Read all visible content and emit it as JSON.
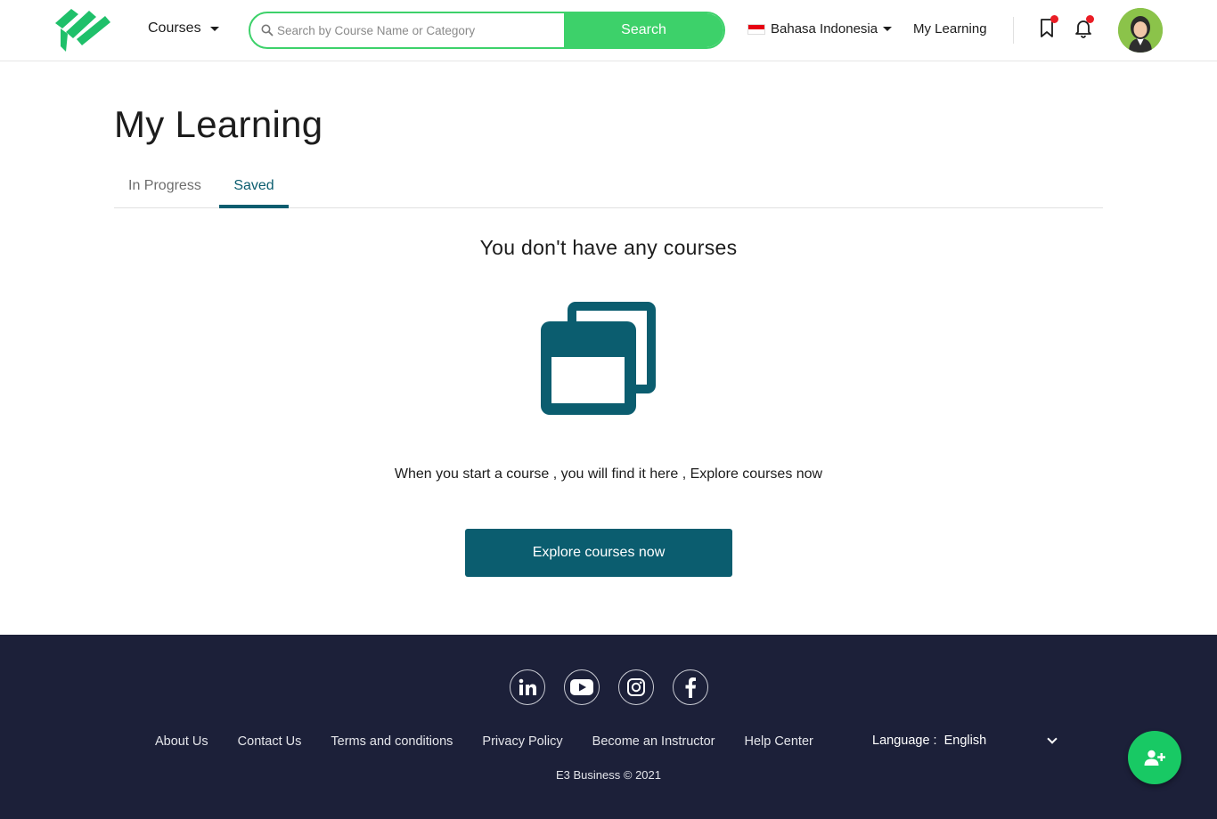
{
  "header": {
    "courses_label": "Courses",
    "search": {
      "placeholder": "Search by Course Name or Category",
      "value": "",
      "button_label": "Search"
    },
    "language": {
      "label": "Bahasa Indonesia",
      "flag": "indonesia-flag"
    },
    "my_learning_label": "My Learning",
    "icons": {
      "bookmark": "bookmark-icon",
      "notification": "bell-icon"
    }
  },
  "main": {
    "title": "My Learning",
    "tabs": [
      {
        "label": "In Progress",
        "active": false
      },
      {
        "label": "Saved",
        "active": true
      }
    ],
    "empty_state": {
      "title": "You don't have any courses",
      "icon": "copy-windows-icon",
      "description": "When you start a course , you will find it here , Explore courses now",
      "button_label": "Explore courses now"
    }
  },
  "footer": {
    "socials": [
      "linkedin-icon",
      "youtube-icon",
      "instagram-icon",
      "facebook-icon"
    ],
    "links": [
      "About Us",
      "Contact Us",
      "Terms and conditions",
      "Privacy Policy",
      "Become an Instructor",
      "Help Center"
    ],
    "language_label": "Language :",
    "language_value": "English",
    "copyright": "E3 Business © 2021"
  },
  "fab": {
    "icon": "add-user-icon"
  },
  "colors": {
    "brand_green": "#3dd16a",
    "primary_teal": "#0b5d6f",
    "footer_bg": "#1c2039",
    "fab_green": "#18c964",
    "dot_red": "#ea1d25"
  }
}
